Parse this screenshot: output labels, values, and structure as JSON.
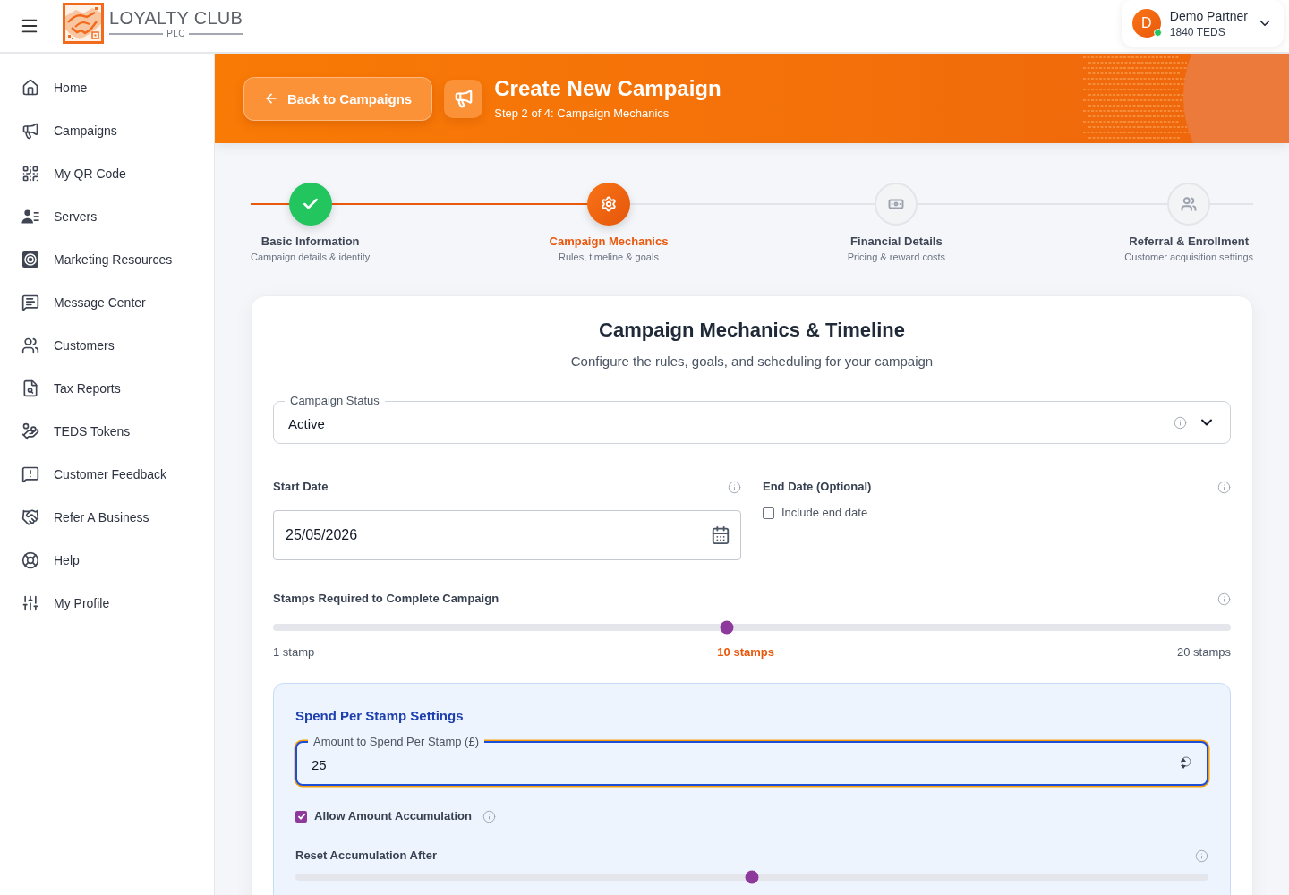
{
  "header": {
    "logo": {
      "title": "LOYALTY CLUB",
      "subtitle": "PLC"
    },
    "user": {
      "initial": "D",
      "name": "Demo Partner",
      "balance": "1840 TEDS",
      "online": true
    }
  },
  "sidebar": {
    "items": [
      {
        "label": "Home"
      },
      {
        "label": "Campaigns"
      },
      {
        "label": "My QR Code"
      },
      {
        "label": "Servers"
      },
      {
        "label": "Marketing Resources"
      },
      {
        "label": "Message Center"
      },
      {
        "label": "Customers"
      },
      {
        "label": "Tax Reports"
      },
      {
        "label": "TEDS Tokens"
      },
      {
        "label": "Customer Feedback"
      },
      {
        "label": "Refer A Business"
      },
      {
        "label": "Help"
      },
      {
        "label": "My Profile"
      }
    ]
  },
  "banner": {
    "back_button": "Back to Campaigns",
    "title": "Create New Campaign",
    "subtitle": "Step 2 of 4: Campaign Mechanics"
  },
  "stepper": {
    "steps": [
      {
        "title": "Basic Information",
        "description": "Campaign details & identity",
        "completed": true,
        "selected": false
      },
      {
        "title": "Campaign Mechanics",
        "description": "Rules, timeline & goals",
        "completed": false,
        "selected": true
      },
      {
        "title": "Financial Details",
        "description": "Pricing & reward costs",
        "completed": false,
        "selected": false
      },
      {
        "title": "Referral & Enrollment",
        "description": "Customer acquisition settings",
        "completed": false,
        "selected": false
      }
    ]
  },
  "form": {
    "title": "Campaign Mechanics & Timeline",
    "subtitle": "Configure the rules, goals, and scheduling for your campaign",
    "campaign_status": {
      "label": "Campaign Status",
      "value": "Active"
    },
    "start_date": {
      "label": "Start Date",
      "value": "25/05/2026"
    },
    "end_date": {
      "label": "End Date (Optional)",
      "checkbox": {
        "label": "Include end date",
        "checked": false
      }
    },
    "stamps_required": {
      "label": "Stamps Required to Complete Campaign",
      "level": 0.474,
      "min_label": "1 stamp",
      "value_label": "10 stamps",
      "max_label": "20 stamps"
    },
    "spend_settings": {
      "title": "Spend Per Stamp Settings",
      "amount": {
        "label": "Amount to Spend Per Stamp (£)",
        "value": "25",
        "focused": true
      },
      "accumulation": {
        "label": "Allow Amount Accumulation",
        "checked": true
      },
      "reset": {
        "label": "Reset Accumulation After",
        "level": 0.5
      }
    }
  }
}
